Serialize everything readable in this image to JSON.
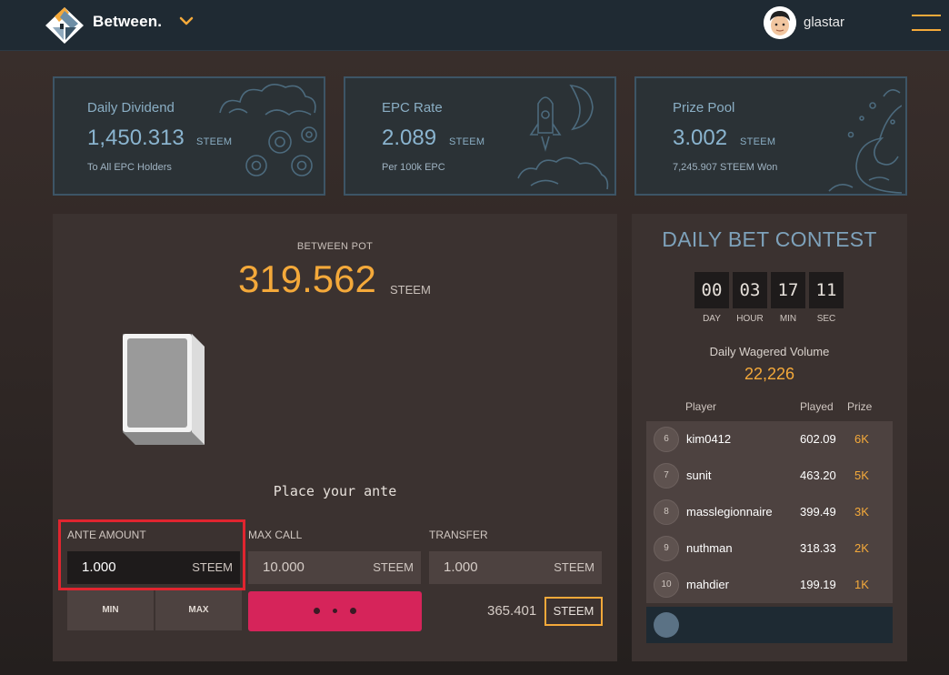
{
  "header": {
    "brand": "Between.",
    "username": "glastar"
  },
  "stats": [
    {
      "title": "Daily Dividend",
      "value": "1,450.313",
      "unit": "STEEM",
      "sub": "To All EPC Holders",
      "icon": "clouds-coins-illustration"
    },
    {
      "title": "EPC Rate",
      "value": "2.089",
      "unit": "STEEM",
      "sub": "Per 100k EPC",
      "icon": "rocket-moon-illustration"
    },
    {
      "title": "Prize Pool",
      "value": "3.002",
      "unit": "STEEM",
      "sub": "7,245.907 STEEM Won",
      "icon": "wave-illustration"
    }
  ],
  "pot": {
    "label": "BETWEEN POT",
    "value": "319.562",
    "unit": "STEEM",
    "message": "Place your ante"
  },
  "fields": {
    "ante": {
      "label": "ANTE AMOUNT",
      "value": "1.000",
      "unit": "STEEM"
    },
    "max_call": {
      "label": "MAX CALL",
      "value": "10.000",
      "unit": "STEEM"
    },
    "transfer": {
      "label": "TRANSFER",
      "value": "1.000",
      "unit": "STEEM"
    }
  },
  "buttons": {
    "min": "MIN",
    "max": "MAX",
    "balance": "365.401",
    "currency": "STEEM"
  },
  "contest": {
    "title": "DAILY BET CONTEST",
    "timer": [
      {
        "value": "00",
        "label": "DAY"
      },
      {
        "value": "03",
        "label": "HOUR"
      },
      {
        "value": "17",
        "label": "MIN"
      },
      {
        "value": "11",
        "label": "SEC"
      }
    ],
    "wager_label": "Daily Wagered Volume",
    "wager_value": "22,226",
    "columns": {
      "player": "Player",
      "played": "Played",
      "prize": "Prize"
    },
    "rows": [
      {
        "rank": "6",
        "player": "kim0412",
        "played": "602.09",
        "prize": "6K"
      },
      {
        "rank": "7",
        "player": "sunit",
        "played": "463.20",
        "prize": "5K"
      },
      {
        "rank": "8",
        "player": "masslegionnaire",
        "played": "399.49",
        "prize": "3K"
      },
      {
        "rank": "9",
        "player": "nuthman",
        "played": "318.33",
        "prize": "2K"
      },
      {
        "rank": "10",
        "player": "mahdier",
        "played": "199.19",
        "prize": "1K"
      }
    ]
  },
  "colors": {
    "accent": "#f4a93a",
    "play": "#d6245a",
    "highlight": "#e0252f",
    "stat_text": "#8ab4cf"
  }
}
